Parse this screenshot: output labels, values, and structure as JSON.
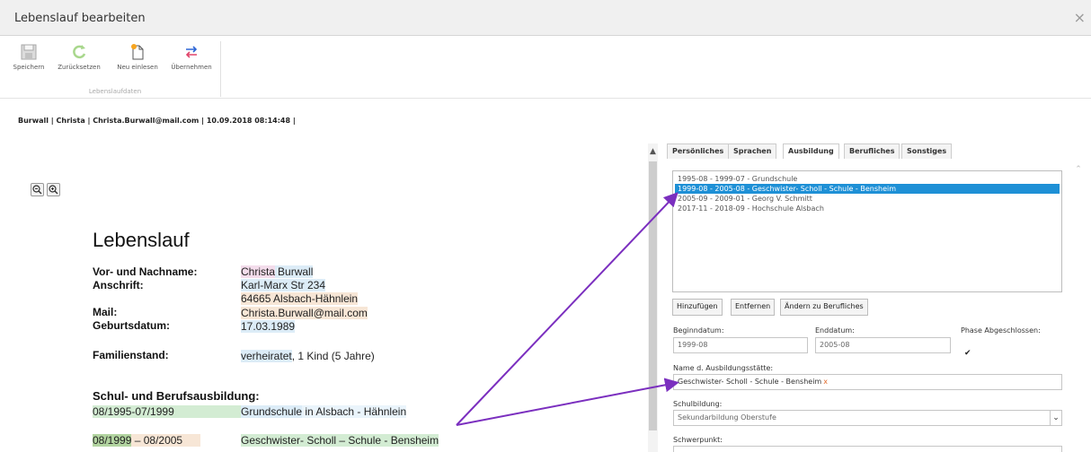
{
  "window": {
    "title": "Lebenslauf bearbeiten",
    "close_symbol": "×"
  },
  "ribbon": {
    "save_label": "Speichern",
    "reset_label": "Zurücksetzen",
    "reload_label": "Neu einlesen",
    "apply_label": "Übernehmen",
    "group_label": "Lebenslaufdaten"
  },
  "info_line": "Burwall | Christa | Christa.Burwall@mail.com | 10.09.2018 08:14:48 |",
  "document": {
    "title": "Lebenslauf",
    "labels": {
      "name": "Vor- und Nachname:",
      "address": "Anschrift:",
      "mail": "Mail:",
      "birthdate": "Geburtsdatum:",
      "family": "Familienstand:",
      "education": "Schul- und Berufsausbildung:"
    },
    "values": {
      "first_name": "Christa",
      "last_name": "Burwall",
      "street": "Karl-Marx Str 234",
      "city": "64665 Alsbach-Hähnlein",
      "mail": "Christa.Burwall@mail.com",
      "birthdate": "17.03.1989",
      "family_status": "verheiratet",
      "family_rest": ", 1 Kind (5 Jahre)",
      "edu1_date": "08/1995-07/1999",
      "edu1_school": "Grundschule",
      "edu1_rest": " in Alsbach - Hähnlein",
      "edu2_date_a": "08/1999",
      "edu2_date_b": " – 08/2005",
      "edu2_school": "Geschwister- Scholl – Schule - Bensheim"
    }
  },
  "tabs": [
    "Persönliches",
    "Sprachen",
    "Ausbildung",
    "Berufliches",
    "Sonstiges"
  ],
  "active_tab": "Ausbildung",
  "education_list": [
    "1995-08 - 1999-07 - Grundschule",
    "1999-08 - 2005-08 - Geschwister- Scholl - Schule - Bensheim",
    "2005-09 - 2009-01 - Georg V. Schmitt",
    "2017-11 - 2018-09 - Hochschule Alsbach"
  ],
  "selected_index": 1,
  "buttons": {
    "add": "Hinzufügen",
    "remove": "Entfernen",
    "change": "Ändern zu Berufliches"
  },
  "form": {
    "begin_label": "Beginndatum:",
    "begin_value": "1999-08",
    "end_label": "Enddatum:",
    "end_value": "2005-08",
    "phase_label": "Phase Abgeschlossen:",
    "phase_checked": "✔",
    "institution_label": "Name d. Ausbildungsstätte:",
    "institution_value": "Geschwister- Scholl - Schule - Bensheim",
    "institution_remove": "x",
    "schooling_label": "Schulbildung:",
    "schooling_value": "Sekundarbildung Oberstufe",
    "focus_label": "Schwerpunkt:"
  },
  "colors": {
    "selection": "#1e90d6",
    "arrow": "#7b2fbf"
  }
}
